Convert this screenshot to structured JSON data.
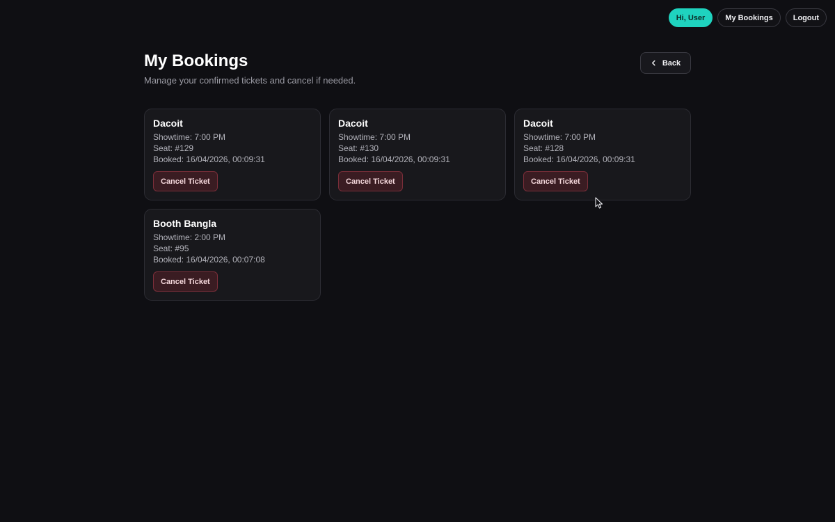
{
  "nav": {
    "greeting": "Hi, User",
    "my_bookings": "My Bookings",
    "logout": "Logout"
  },
  "page": {
    "title": "My Bookings",
    "subtitle": "Manage your confirmed tickets and cancel if needed.",
    "back_label": "Back"
  },
  "bookings": [
    {
      "movie": "Dacoit",
      "showtime": "Showtime: 7:00 PM",
      "seat": "Seat: #129",
      "booked": "Booked: 16/04/2026, 00:09:31",
      "cancel_label": "Cancel Ticket"
    },
    {
      "movie": "Dacoit",
      "showtime": "Showtime: 7:00 PM",
      "seat": "Seat: #130",
      "booked": "Booked: 16/04/2026, 00:09:31",
      "cancel_label": "Cancel Ticket"
    },
    {
      "movie": "Dacoit",
      "showtime": "Showtime: 7:00 PM",
      "seat": "Seat: #128",
      "booked": "Booked: 16/04/2026, 00:09:31",
      "cancel_label": "Cancel Ticket"
    },
    {
      "movie": "Booth Bangla",
      "showtime": "Showtime: 2:00 PM",
      "seat": "Seat: #95",
      "booked": "Booked: 16/04/2026, 00:07:08",
      "cancel_label": "Cancel Ticket"
    }
  ],
  "icons": {
    "back": "chevron-left-icon",
    "cursor": "mouse-pointer-icon"
  },
  "colors": {
    "background": "#0f0f13",
    "accent": "#1fd3bf",
    "danger_bg": "#3a1c22",
    "danger_border": "#7a2e39"
  }
}
